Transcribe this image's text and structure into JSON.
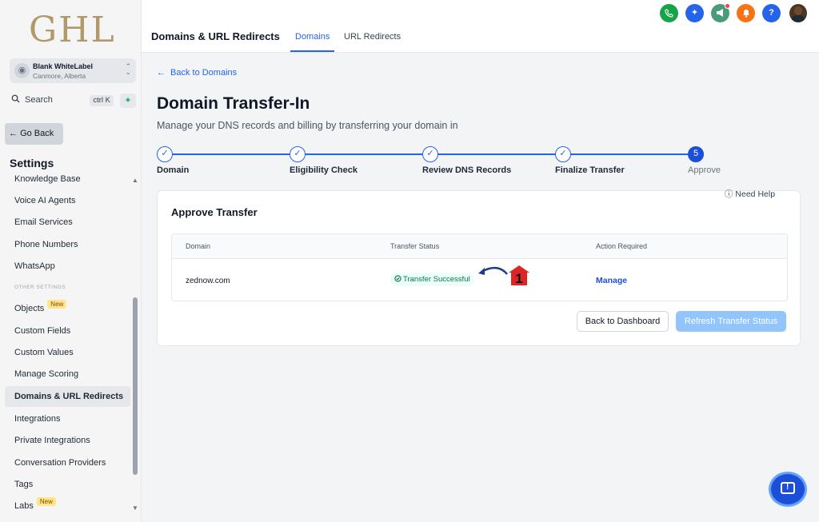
{
  "sidebar": {
    "logo": "GHL",
    "account": {
      "name": "Blank WhiteLabel",
      "location": "Canmore, Alberta"
    },
    "search": {
      "label": "Search",
      "shortcut": "ctrl K"
    },
    "go_back": "Go Back",
    "settings_title": "Settings",
    "items": [
      {
        "label": "Knowledge Base",
        "badge": ""
      },
      {
        "label": "Voice AI Agents"
      },
      {
        "label": "Email Services"
      },
      {
        "label": "Phone Numbers"
      },
      {
        "label": "WhatsApp"
      },
      {
        "label": "Objects",
        "badge": "New"
      },
      {
        "label": "Custom Fields"
      },
      {
        "label": "Custom Values"
      },
      {
        "label": "Manage Scoring"
      },
      {
        "label": "Domains & URL Redirects",
        "active": true
      },
      {
        "label": "Integrations"
      },
      {
        "label": "Private Integrations"
      },
      {
        "label": "Conversation Providers"
      },
      {
        "label": "Tags"
      },
      {
        "label": "Labs",
        "badge": "New"
      }
    ],
    "other_settings_label": "OTHER SETTINGS"
  },
  "header": {
    "page_title": "Domains & URL Redirects",
    "tabs": [
      {
        "label": "Domains",
        "active": true
      },
      {
        "label": "URL Redirects"
      }
    ],
    "icons": [
      {
        "name": "phone-icon",
        "color": "#16a34a"
      },
      {
        "name": "magic-icon",
        "color": "#2563eb"
      },
      {
        "name": "megaphone-icon",
        "color": "#4b9a7a"
      },
      {
        "name": "bell-icon",
        "color": "#f97316"
      },
      {
        "name": "help-icon",
        "color": "#2563eb"
      }
    ]
  },
  "main": {
    "back_link": "Back to Domains",
    "title": "Domain Transfer-In",
    "subtitle": "Manage your DNS records and billing by transferring your domain in",
    "steps": [
      {
        "label": "Domain",
        "state": "done"
      },
      {
        "label": "Eligibility Check",
        "state": "done"
      },
      {
        "label": "Review DNS Records",
        "state": "done"
      },
      {
        "label": "Finalize Transfer",
        "state": "done"
      },
      {
        "label": "Approve",
        "state": "current",
        "number": "5"
      }
    ],
    "need_help": "Need Help",
    "card_title": "Approve Transfer",
    "table": {
      "headers": [
        "Domain",
        "Transfer Status",
        "Action Required"
      ],
      "row": {
        "domain": "zednow.com",
        "status": "Transfer Successful",
        "action": "Manage"
      }
    },
    "annotation_number": "1",
    "buttons": {
      "back_dashboard": "Back to Dashboard",
      "refresh": "Refresh Transfer Status"
    }
  }
}
